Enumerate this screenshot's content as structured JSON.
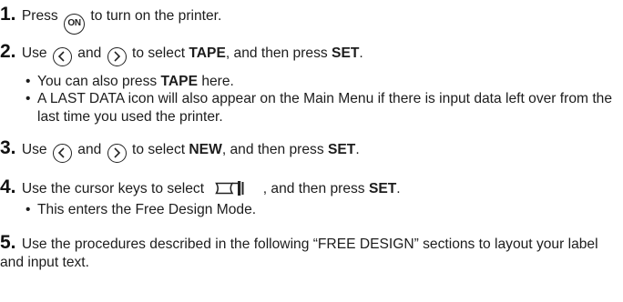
{
  "steps": [
    {
      "number": "1.",
      "parts": {
        "a": "Press",
        "button": "ON",
        "b": "to turn on the printer."
      }
    },
    {
      "number": "2.",
      "parts": {
        "a": "Use",
        "and": "and",
        "b": "to select",
        "key1": "TAPE",
        "c": ", and then press",
        "key2": "SET",
        "d": "."
      },
      "bullets": [
        {
          "a": "You can also press",
          "key": "TAPE",
          "b": "here."
        },
        {
          "text": "A LAST DATA icon will also appear on the Main Menu if there is input data left over from the last time you used the printer."
        }
      ]
    },
    {
      "number": "3.",
      "parts": {
        "a": "Use",
        "and": "and",
        "b": "to select",
        "key1": "NEW",
        "c": ", and then press",
        "key2": "SET",
        "d": "."
      }
    },
    {
      "number": "4.",
      "parts": {
        "a": "Use the cursor keys to select",
        "c": ", and then press",
        "key2": "SET",
        "d": "."
      },
      "bullets": [
        {
          "text": "This enters the Free Design Mode."
        }
      ]
    },
    {
      "number": "5.",
      "text": "Use the procedures described in the following “FREE DESIGN” sections to layout your label and input text."
    }
  ],
  "bullet_char": "•",
  "icons": {
    "left": "chevron-left-icon",
    "right": "chevron-right-icon",
    "on": "on-button-icon",
    "free_design": "free-design-tape-icon"
  }
}
